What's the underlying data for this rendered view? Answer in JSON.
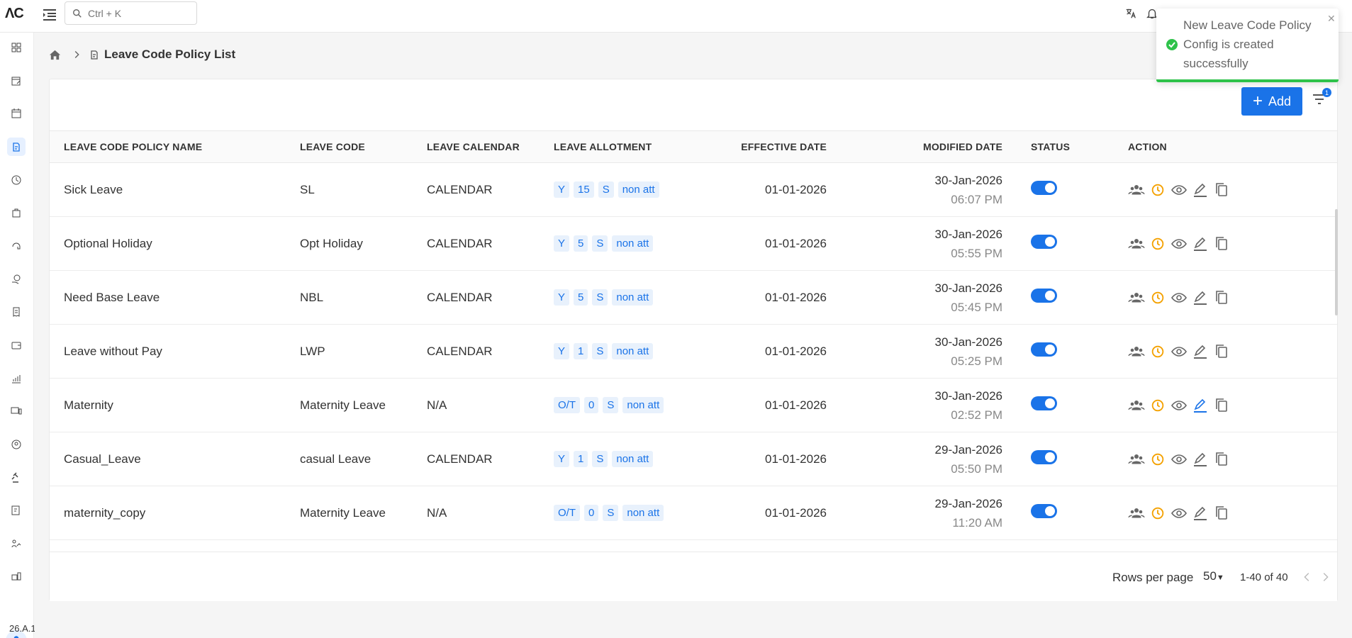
{
  "topbar": {
    "logo": "ΛC",
    "search_placeholder": "Ctrl + K"
  },
  "breadcrumb": {
    "title": "Leave Code Policy List"
  },
  "toolbar": {
    "add_label": "Add",
    "filter_count": "1"
  },
  "table": {
    "headers": [
      "LEAVE CODE POLICY NAME",
      "LEAVE CODE",
      "LEAVE CALENDAR",
      "LEAVE ALLOTMENT",
      "EFFECTIVE DATE",
      "MODIFIED DATE",
      "STATUS",
      "ACTION"
    ],
    "rows": [
      {
        "name": "Sick Leave",
        "code": "SL",
        "calendar": "CALENDAR",
        "allotment": [
          "Y",
          "15",
          "S",
          "non att"
        ],
        "effective": "01-01-2026",
        "mod_date": "30-Jan-2026",
        "mod_time": "06:07 PM",
        "status": true
      },
      {
        "name": "Optional Holiday",
        "code": "Opt Holiday",
        "calendar": "CALENDAR",
        "allotment": [
          "Y",
          "5",
          "S",
          "non att"
        ],
        "effective": "01-01-2026",
        "mod_date": "30-Jan-2026",
        "mod_time": "05:55 PM",
        "status": true
      },
      {
        "name": "Need Base Leave",
        "code": "NBL",
        "calendar": "CALENDAR",
        "allotment": [
          "Y",
          "5",
          "S",
          "non att"
        ],
        "effective": "01-01-2026",
        "mod_date": "30-Jan-2026",
        "mod_time": "05:45 PM",
        "status": true
      },
      {
        "name": "Leave without Pay",
        "code": "LWP",
        "calendar": "CALENDAR",
        "allotment": [
          "Y",
          "1",
          "S",
          "non att"
        ],
        "effective": "01-01-2026",
        "mod_date": "30-Jan-2026",
        "mod_time": "05:25 PM",
        "status": true
      },
      {
        "name": "Maternity",
        "code": "Maternity Leave",
        "calendar": "N/A",
        "allotment": [
          "O/T",
          "0",
          "S",
          "non att"
        ],
        "effective": "01-01-2026",
        "mod_date": "30-Jan-2026",
        "mod_time": "02:52 PM",
        "status": true
      },
      {
        "name": "Casual_Leave",
        "code": "casual Leave",
        "calendar": "CALENDAR",
        "allotment": [
          "Y",
          "1",
          "S",
          "non att"
        ],
        "effective": "01-01-2026",
        "mod_date": "29-Jan-2026",
        "mod_time": "05:50 PM",
        "status": true
      },
      {
        "name": "maternity_copy",
        "code": "Maternity Leave",
        "calendar": "N/A",
        "allotment": [
          "O/T",
          "0",
          "S",
          "non att"
        ],
        "effective": "01-01-2026",
        "mod_date": "29-Jan-2026",
        "mod_time": "11:20 AM",
        "status": true
      }
    ]
  },
  "pagination": {
    "rows_per_page_label": "Rows per page",
    "rows_per_page_value": "50",
    "range": "1-40 of 40"
  },
  "toast": {
    "message": "New Leave Code Policy Config is created successfully"
  },
  "sidebar": {
    "version": "26.A.1"
  },
  "colors": {
    "primary": "#1a73e8",
    "success": "#2ec24a",
    "history_icon": "#f4a100"
  }
}
